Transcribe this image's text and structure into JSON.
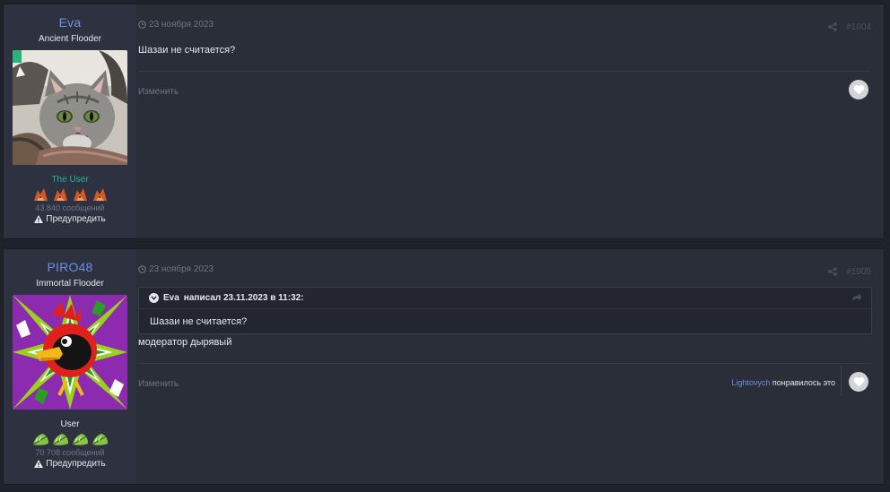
{
  "posts": [
    {
      "author": "Eva",
      "title": "Ancient Flooder",
      "group": "The User",
      "post_count": "43 840 сообщений",
      "warn_label": "Предупредить",
      "date": "23 ноября 2023",
      "number": "#1004",
      "text": "Шазаи не считается?",
      "edit_label": "Изменить"
    },
    {
      "author": "PIRO48",
      "title": "Immortal Flooder",
      "group": "User",
      "post_count": "70 708 сообщений",
      "warn_label": "Предупредить",
      "date": "23 ноября 2023",
      "number": "#1005",
      "quote": {
        "author": "Eva",
        "header_rest": "написал 23.11.2023 в 11:32:",
        "text": "Шазаи не считается?"
      },
      "text": "модератор дырявый",
      "edit_label": "Изменить",
      "reaction": {
        "user": "Lightovych",
        "text": "понравилось это"
      }
    }
  ],
  "colors": {
    "page_bg": "#1f222b",
    "post_bg": "#2a2e39",
    "author_bg": "#2d3140",
    "username": "#6c8fe0",
    "group_user": "#22b5a0",
    "muted": "#6f7583"
  },
  "icons": {
    "clock": "clock-icon",
    "share": "share-icon",
    "like": "heart-icon",
    "warn": "warning-icon",
    "quote_toggle": "chevron-down-icon",
    "quote_jump": "reply-arrow-icon"
  }
}
